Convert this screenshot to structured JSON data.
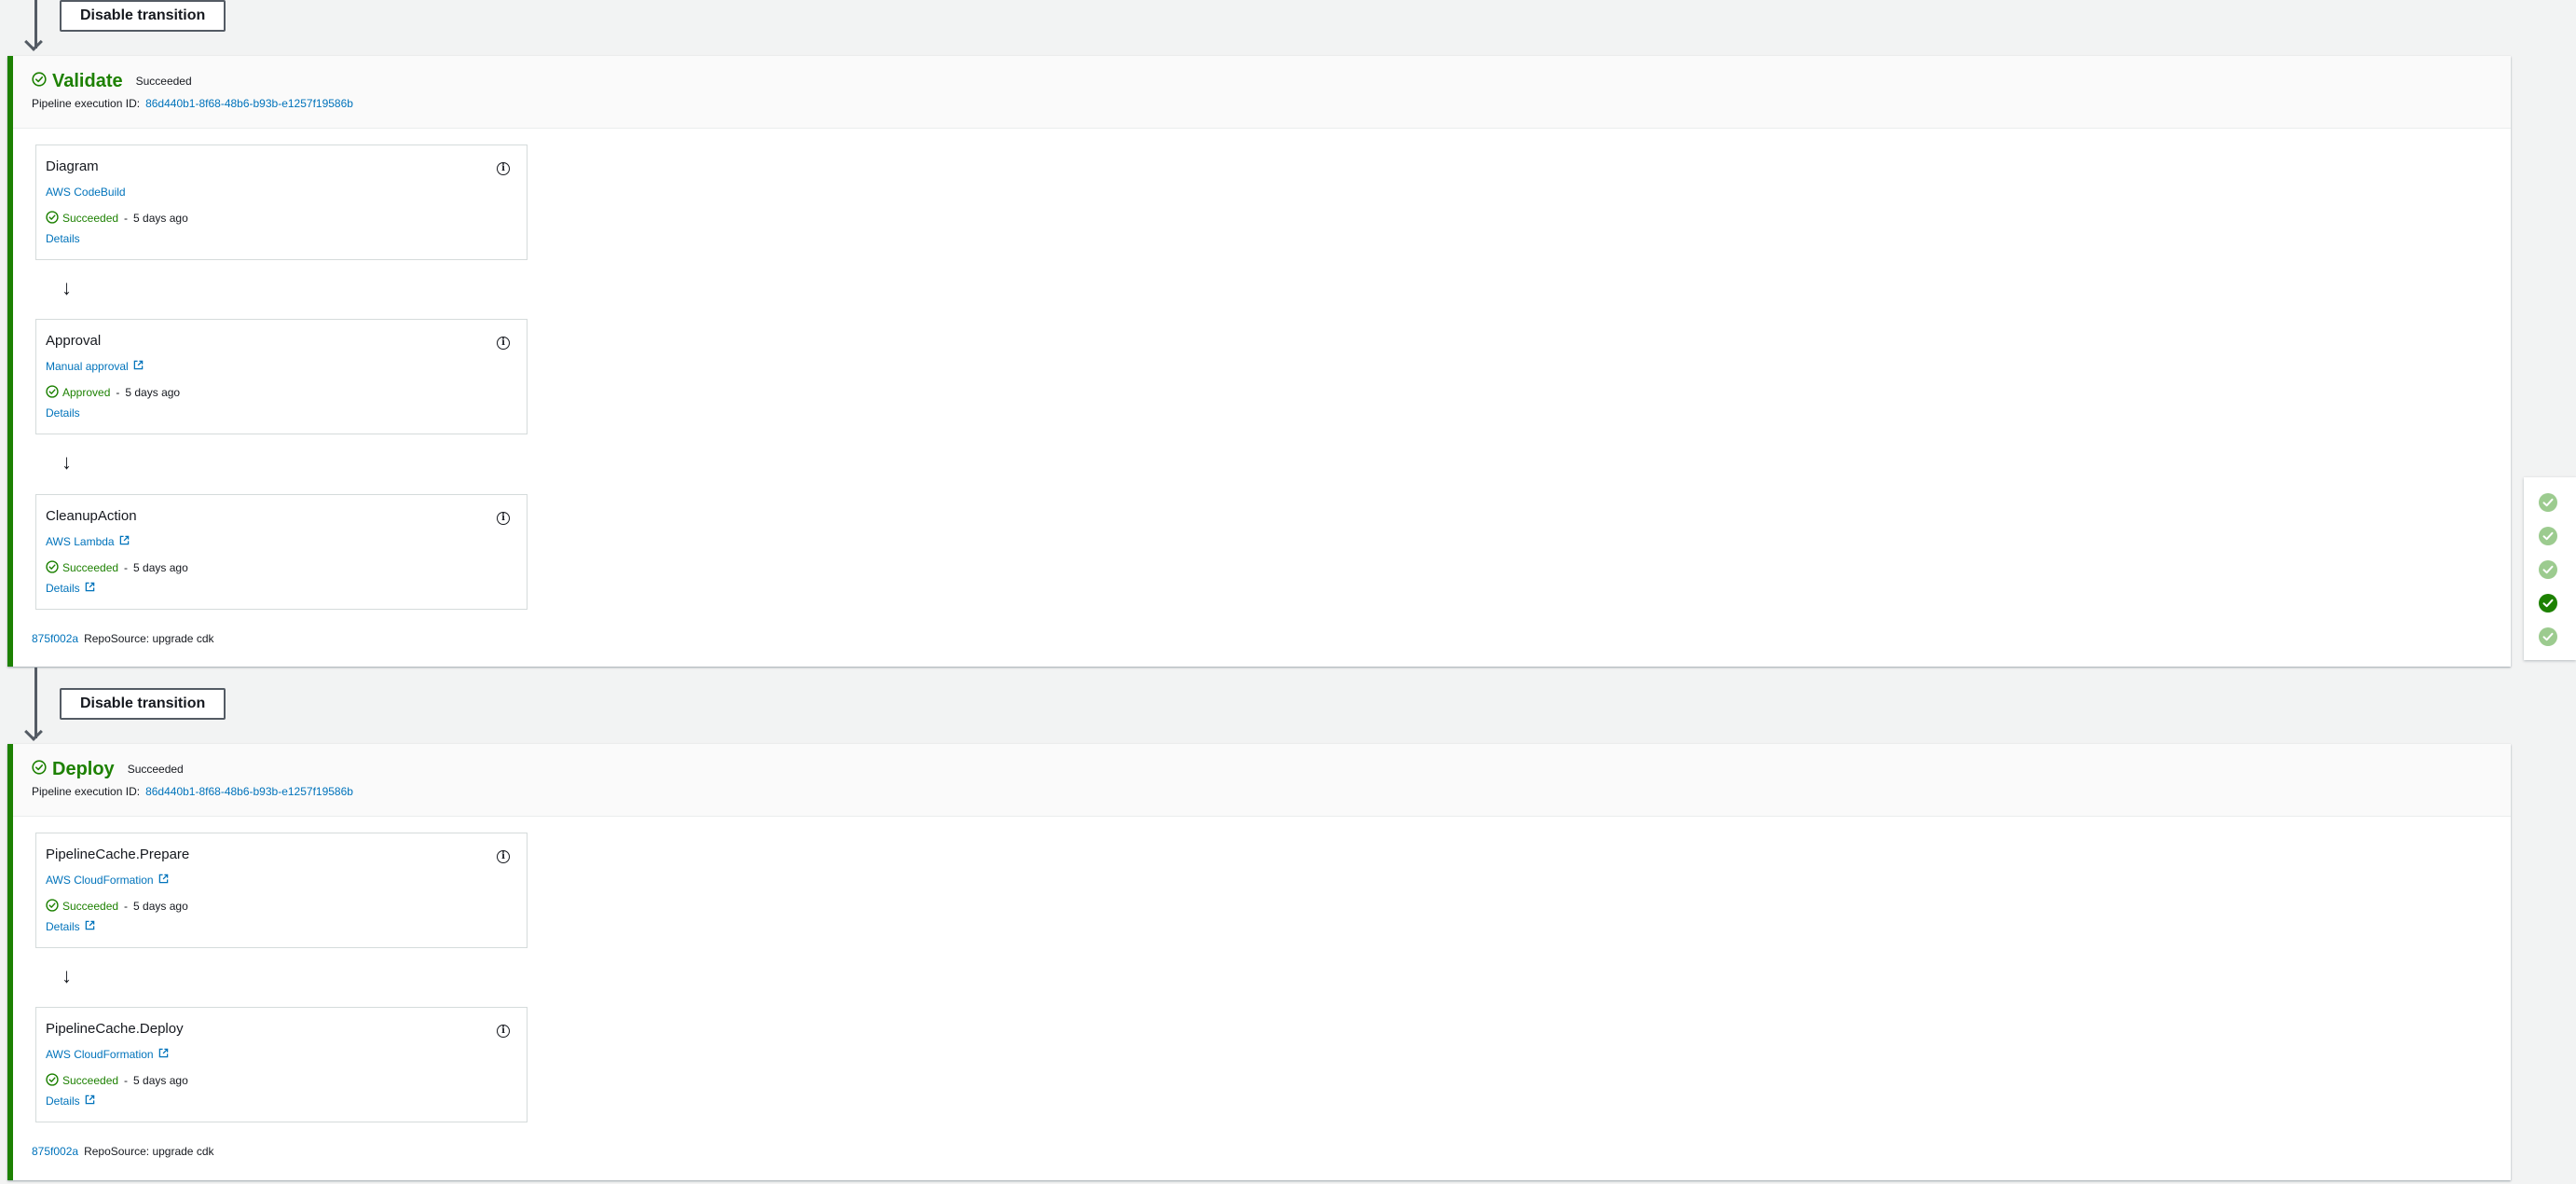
{
  "transitions": [
    {
      "button_label": "Disable transition"
    },
    {
      "button_label": "Disable transition"
    }
  ],
  "stages": [
    {
      "name": "Validate",
      "status": "Succeeded",
      "execution_label": "Pipeline execution ID:",
      "execution_id": "86d440b1-8f68-48b6-b93b-e1257f19586b",
      "actions": [
        {
          "name": "Diagram",
          "provider": "AWS CodeBuild",
          "provider_external": false,
          "status": "Succeeded",
          "time": "5 days ago",
          "details": "Details",
          "details_external": false
        },
        {
          "name": "Approval",
          "provider": "Manual approval",
          "provider_external": true,
          "status": "Approved",
          "time": "5 days ago",
          "details": "Details",
          "details_external": false
        },
        {
          "name": "CleanupAction",
          "provider": "AWS Lambda",
          "provider_external": true,
          "status": "Succeeded",
          "time": "5 days ago",
          "details": "Details",
          "details_external": true
        }
      ],
      "footer": {
        "commit": "875f002a",
        "message": "RepoSource: upgrade cdk"
      }
    },
    {
      "name": "Deploy",
      "status": "Succeeded",
      "execution_label": "Pipeline execution ID:",
      "execution_id": "86d440b1-8f68-48b6-b93b-e1257f19586b",
      "actions": [
        {
          "name": "PipelineCache.Prepare",
          "provider": "AWS CloudFormation",
          "provider_external": true,
          "status": "Succeeded",
          "time": "5 days ago",
          "details": "Details",
          "details_external": true
        },
        {
          "name": "PipelineCache.Deploy",
          "provider": "AWS CloudFormation",
          "provider_external": true,
          "status": "Succeeded",
          "time": "5 days ago",
          "details": "Details",
          "details_external": true
        }
      ],
      "footer": {
        "commit": "875f002a",
        "message": "RepoSource: upgrade cdk"
      }
    }
  ],
  "status_separator": "-",
  "stage_navigator": {
    "dots": [
      {
        "state": "succeeded"
      },
      {
        "state": "succeeded"
      },
      {
        "state": "succeeded"
      },
      {
        "state": "current"
      },
      {
        "state": "succeeded"
      }
    ]
  },
  "colors": {
    "success": "#1d8102",
    "link": "#0073bb",
    "nav_dot_light": "#9ccb8f",
    "nav_dot_dark": "#1d8102"
  },
  "icons": {
    "status": "check-circle-icon",
    "info": "info-icon",
    "external": "external-link-icon",
    "flow": "arrow-down-icon"
  }
}
